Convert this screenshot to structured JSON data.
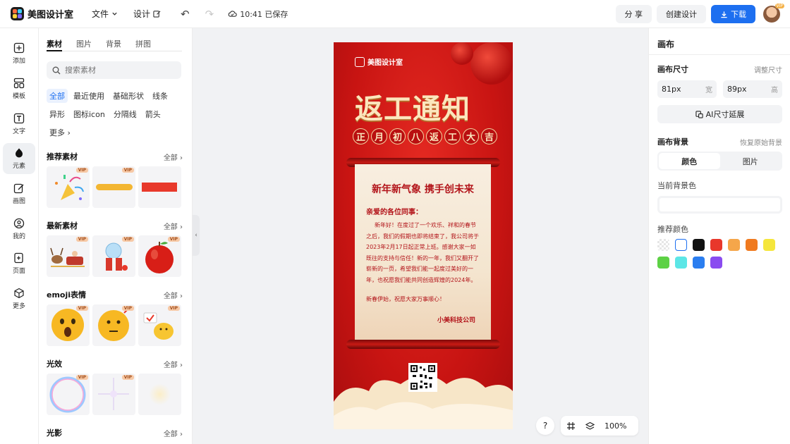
{
  "app": {
    "name": "美图设计室",
    "menu": [
      "文件",
      "设计"
    ],
    "save_status": "10:41 已保存",
    "actions": {
      "share": "分 享",
      "create": "创建设计",
      "download": "下载"
    },
    "avatar_badge": "VIP"
  },
  "rail": [
    {
      "label": "添加",
      "icon": "plus-square-icon"
    },
    {
      "label": "模板",
      "icon": "template-icon"
    },
    {
      "label": "文字",
      "icon": "text-icon"
    },
    {
      "label": "元素",
      "icon": "shapes-icon",
      "active": true
    },
    {
      "label": "画图",
      "icon": "pencil-icon"
    },
    {
      "label": "我的",
      "icon": "user-icon"
    },
    {
      "label": "页面",
      "icon": "page-add-icon"
    },
    {
      "label": "更多",
      "icon": "cube-icon"
    }
  ],
  "panel": {
    "tabs": [
      "素材",
      "图片",
      "背景",
      "拼图"
    ],
    "search_placeholder": "搜索素材",
    "chips": [
      "全部",
      "最近使用",
      "基础形状",
      "线条",
      "异形",
      "图标icon",
      "分隔线",
      "箭头",
      "更多"
    ],
    "all_label": "全部",
    "vip_label": "VIP",
    "sections": [
      "推荐素材",
      "最新素材",
      "emoji表情",
      "光效",
      "光影"
    ]
  },
  "poster": {
    "logo": "美图设计室",
    "title": "返工通知",
    "subtitle": [
      "正",
      "月",
      "初",
      "八",
      "返",
      "工",
      "大",
      "吉"
    ],
    "heading": "新年新气象 携手创未来",
    "greeting": "亲爱的各位同事：",
    "body": "新年好！在度过了一个欢乐、祥和的春节之后，我们的假期也即将结束了，我公司将于2023年2月17日起正常上班。感谢大家一如既往的支持与信任！新的一年，我们又翻开了崭新的一页，希望我们能一起度过美好的一年，也祝愿我们能共同创造辉煌的2024年。",
    "closing": "新春伊始，祝愿大家万事顺心！",
    "signature": "小美科技公司"
  },
  "canvas_tools": {
    "help": "?",
    "zoom": "100%"
  },
  "right": {
    "title": "画布",
    "size_label": "画布尺寸",
    "adjust_size": "调整尺寸",
    "width_value": "81px",
    "width_unit": "宽",
    "height_value": "89px",
    "height_unit": "高",
    "ai_button": "AI尺寸延展",
    "bg_label": "画布背景",
    "restore_bg": "恢复原始背景",
    "seg": [
      "颜色",
      "图片"
    ],
    "current_bg_label": "当前背景色",
    "recommend_label": "推荐颜色",
    "colors": [
      "transparent",
      "#ffffff",
      "#111111",
      "#e8372b",
      "#f5a64a",
      "#f07a1f",
      "#f5e63c",
      "#5dd145",
      "#5ce6e6",
      "#2b7ef0",
      "#8a4cf0"
    ]
  }
}
